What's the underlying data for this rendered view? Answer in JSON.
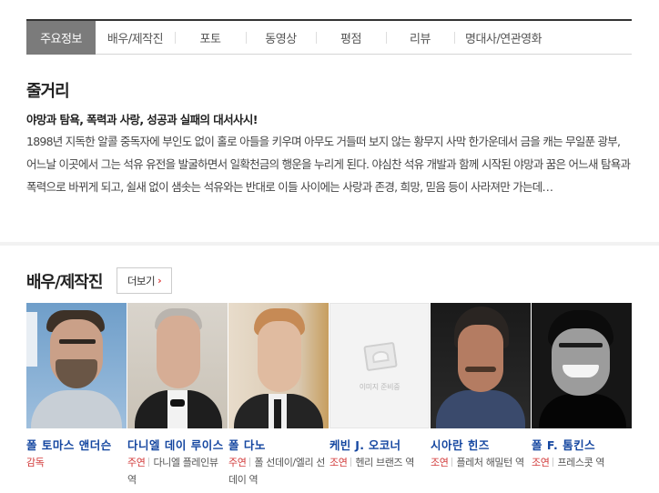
{
  "tabs": [
    {
      "label": "주요정보",
      "active": true
    },
    {
      "label": "배우/제작진",
      "active": false
    },
    {
      "label": "포토",
      "active": false
    },
    {
      "label": "동영상",
      "active": false
    },
    {
      "label": "평점",
      "active": false
    },
    {
      "label": "리뷰",
      "active": false
    },
    {
      "label": "명대사/연관영화",
      "active": false
    }
  ],
  "synopsis": {
    "title": "줄거리",
    "headline": "야망과 탐욕, 폭력과 사랑, 성공과 실패의 대서사시!",
    "body": "1898년 지독한 알콜 중독자에 부인도 없이 홀로 아들을 키우며 아무도 거들떠 보지 않는 황무지 사막 한가운데서 금을 캐는 무일푼 광부, 어느날 이곳에서 그는 석유 유전을 발굴하면서 일확천금의 행운을 누리게 된다. 야심찬 석유 개발과 함께 시작된 야망과 꿈은 어느새 탐욕과 폭력으로 바뀌게 되고, 쉴새 없이 샘솟는 석유와는 반대로 이들 사이에는 사랑과 존경, 희망, 믿음 등이 사라져만 가는데…"
  },
  "cast": {
    "title": "배우/제작진",
    "more_label": "더보기",
    "more_arrow": "›",
    "no_image_text": "이미지 준비중",
    "people": [
      {
        "name": "폴 토마스 앤더슨",
        "role": "감독",
        "char": ""
      },
      {
        "name": "다니엘 데이 루이스",
        "role": "주연",
        "char": "다니엘 플레인뷰 역"
      },
      {
        "name": "폴 다노",
        "role": "주연",
        "char": "폴 선데이/엘리 선데이 역"
      },
      {
        "name": "케빈 J. 오코너",
        "role": "조연",
        "char": "헨리 브랜즈 역"
      },
      {
        "name": "시아란 힌즈",
        "role": "조연",
        "char": "플레처 해밀턴 역"
      },
      {
        "name": "폴 F. 톰킨스",
        "role": "조연",
        "char": "프레스콧 역"
      }
    ]
  },
  "colors": {
    "active_tab": "#7b7b7b",
    "name_link": "#1446a0",
    "role_red": "#d23a3a"
  }
}
